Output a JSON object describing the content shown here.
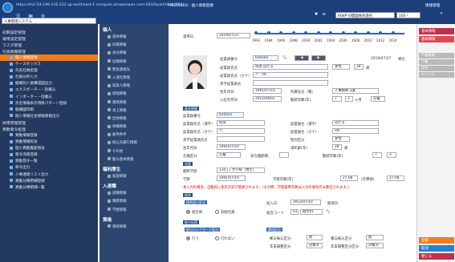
{
  "browser": {
    "url": "https://m2-54-199-216-232.ap-northeast-1.compute.amazonaws.com:443/QuartzWeb/001/",
    "title": "HE210100：個人情報登録"
  },
  "topbar": {
    "company": "RIWP-SI開発株式会社",
    "zoom": "100・",
    "user": "情報管理",
    "search": "人事管理システム"
  },
  "sidebar": {
    "groups": [
      {
        "label": "初期設定管理"
      },
      {
        "label": "運用設定管理"
      },
      {
        "label": "マスタ管理"
      },
      {
        "label": "社員情報管理"
      }
    ],
    "items": [
      {
        "label": "個人情報登録",
        "active": true
      },
      {
        "label": "ケースボックス"
      },
      {
        "label": "氏名社員処理"
      },
      {
        "label": "社員分析入力"
      },
      {
        "label": "組織別人員構成図出力"
      },
      {
        "label": "エクスポーター－括載込"
      },
      {
        "label": "インポーター－括載込"
      },
      {
        "label": "氏名情報表示項目パターン登録"
      },
      {
        "label": "組織図印刷"
      },
      {
        "label": "個人情報社会保険情報出力"
      }
    ],
    "groups2": [
      {
        "label": "採用管理管理"
      },
      {
        "label": "異動発令処理"
      }
    ],
    "items2": [
      {
        "label": "異動情報登録"
      },
      {
        "label": "異動情報照会"
      },
      {
        "label": "個人異動履歴照会"
      },
      {
        "label": "発令決裁登録"
      },
      {
        "label": "異動発令一覧"
      },
      {
        "label": "辞令出力"
      },
      {
        "label": "人事通達リスト出力"
      },
      {
        "label": "異動分類明細登録"
      },
      {
        "label": "異動分類明細一覧"
      }
    ]
  },
  "menu2": {
    "sections": [
      {
        "title": "個人",
        "items": [
          "基本情報",
          "所属情報",
          "身分情報",
          "役職情報",
          "緊急連絡先",
          "入退社情報",
          "家族人情報",
          "保険情報",
          "資格情報",
          "身上情報",
          "団体情報",
          "休職情報",
          "雇用条件",
          "振込先銀行情報",
          "その他",
          "勤与基本情報"
        ]
      },
      {
        "title": "福利厚生",
        "items": [
          "家族情報"
        ]
      },
      {
        "title": "入退職",
        "items": [
          "退職情報",
          "職歴情報",
          "学歴情報"
        ]
      },
      {
        "title": "資格",
        "items": [
          "資格情報"
        ]
      }
    ]
  },
  "main": {
    "base_date_label": "基準日",
    "base_date": "2019/07/27",
    "years": [
      "1992",
      "1994",
      "1996",
      "1998",
      "2000",
      "2002",
      "2004",
      "2006",
      "2008",
      "2010",
      "2012",
      "2014"
    ],
    "emp_no_label": "従業員番号",
    "emp_no": "010101",
    "ref_date": "2019/07/27",
    "ref_status": "異在",
    "name_label": "従業員氏名",
    "name": "阿部 はたる",
    "gender": "女性",
    "age": "28",
    "age_unit": "歳",
    "kana_label": "従業員氏名（カナ）",
    "kana": "ｱﾍﾞ ﾊﾀﾙ",
    "eng_label": "英字従業員名",
    "birth_label": "生年月日",
    "birth": "1991/07/10",
    "dept_label": "所属先名（略）",
    "dept": "人事総務 3課",
    "join_label": "入社年月日",
    "join": "2012/04/01",
    "tenure_label": "勤続年数(年)",
    "tenure_y": "7",
    "tenure_m": "3",
    "tenure_note": "ヶ月",
    "tenure_flag": "在籍",
    "sec_basic": "基本情報",
    "b_no_label": "従業員番号",
    "b_no": "010101",
    "b_name_label": "従業員氏名（漢字）",
    "b_sei": "阿部",
    "b_mei_label": "従業員名（漢字）",
    "b_mei": "はたる",
    "b_kana_label": "従業員氏名（カナ）",
    "b_kana_sei": "ｱﾍﾞ",
    "b_kana_mei_label": "従業員名（カナ）",
    "b_kana_mei": "ﾊﾀﾙ",
    "b_eng_label": "英字従業員氏名",
    "b_gender_label": "性別区分",
    "b_gender": "女性",
    "b_birth_label": "生年月日",
    "b_birth": "1991/07/10",
    "b_age_label": "満年齢(年)",
    "b_age": "28",
    "b_age_unit": "歳",
    "b_status_label": "在籍区分",
    "b_status": "在籍",
    "b_tenure_label": "非在籍期間",
    "b_cont_label": "勤続年数(年)",
    "b_cont_y": "7",
    "b_cont_m": "3",
    "sec_school": "学歴",
    "school_label": "最終学歴",
    "school_code": "110",
    "school_name": "大学院（博士）",
    "grad_label": "学歴",
    "grad_date": "1991/07/10",
    "grad_label2": "学歴年数(年)",
    "grad_y": "27.08",
    "grad_calc": "(計算値)",
    "grad_v": "27.08",
    "warning": "本入力の場合、自動的に生年月日が登録されます。（その際、学歴基準年数は入力の場合のみ算出されます。）",
    "sec_assoc": "組合",
    "assoc_join_label": "組合加入区分",
    "assoc_opt1": "組合員",
    "assoc_opt2": "非組合員",
    "assoc_date_label": "加入日",
    "assoc_date": "2012/07/10",
    "assoc_date2": "脱退日",
    "assoc_code_label": "組合コード",
    "assoc_code": "01",
    "assoc_name": "組合01",
    "sec_salary": "給与処理",
    "sal_label": "給与ロックガード区分",
    "sal_opt1": "行う",
    "sal_opt2": "行わない",
    "mail_label": "郵送区分",
    "m1_label": "郵与振込区分",
    "m1": "無",
    "m2_label": "賞与振込区分",
    "m2": "無",
    "m3_label": "年末調整区分",
    "m3": "対象外",
    "m4_label": "年末調整区分区分",
    "m4": "対象外"
  },
  "right": {
    "buttons": [
      {
        "label": "基本情報",
        "color": "#c0304a"
      },
      {
        "label": "基本情報",
        "color": "#e0484e"
      }
    ],
    "greys": [
      "戸籍情報",
      "戸籍",
      "住所",
      "リリース"
    ],
    "footer": [
      {
        "label": "登録",
        "color": "#f07c1c"
      },
      {
        "label": "取消",
        "color": "#2a7fd4"
      },
      {
        "label": "閉じる",
        "color": "#c0304a"
      }
    ]
  }
}
